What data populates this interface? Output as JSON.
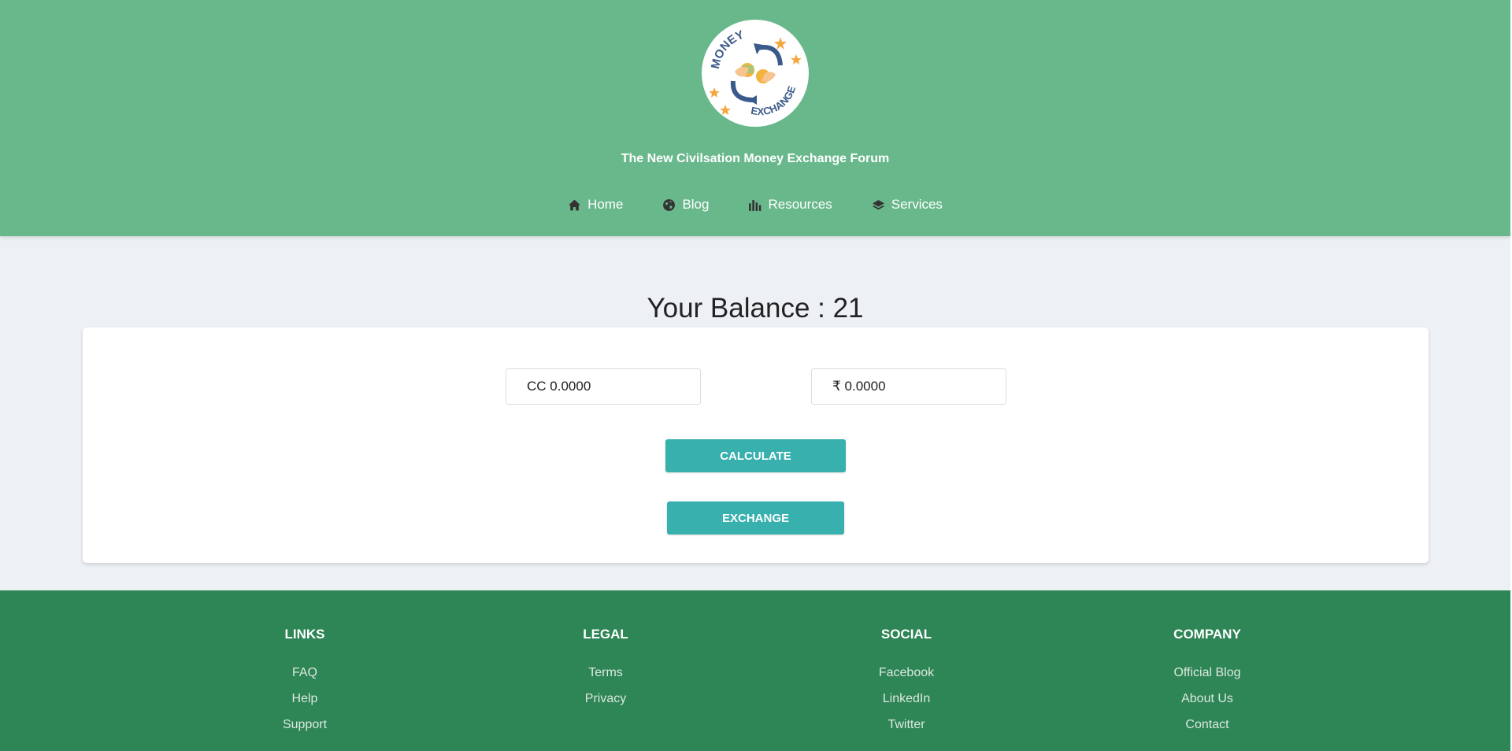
{
  "header": {
    "logo": {
      "top_text": "MONEY",
      "bottom_text": "EXCHANGE"
    },
    "site_title": "The New Civilsation Money Exchange Forum",
    "nav": [
      {
        "label": "Home",
        "icon": "home-icon"
      },
      {
        "label": "Blog",
        "icon": "globe-icon"
      },
      {
        "label": "Resources",
        "icon": "bar-chart-icon"
      },
      {
        "label": "Services",
        "icon": "layers-icon"
      }
    ]
  },
  "balance": {
    "text": "Your Balance : 21"
  },
  "converter": {
    "cc_field": {
      "value": "CC 0.0000"
    },
    "inr_field": {
      "value": "₹ 0.0000"
    },
    "calculate_label": "CALCULATE",
    "exchange_label": "EXCHANGE"
  },
  "footer": {
    "columns": [
      {
        "heading": "LINKS",
        "links": [
          "FAQ",
          "Help",
          "Support"
        ]
      },
      {
        "heading": "LEGAL",
        "links": [
          "Terms",
          "Privacy"
        ]
      },
      {
        "heading": "SOCIAL",
        "links": [
          "Facebook",
          "LinkedIn",
          "Twitter"
        ]
      },
      {
        "heading": "COMPANY",
        "links": [
          "Official Blog",
          "About Us",
          "Contact"
        ]
      }
    ]
  },
  "colors": {
    "header_bg": "#69b88c",
    "page_bg": "#edf1f5",
    "button_bg": "#38b0ae",
    "footer_bg": "#2e8555"
  }
}
